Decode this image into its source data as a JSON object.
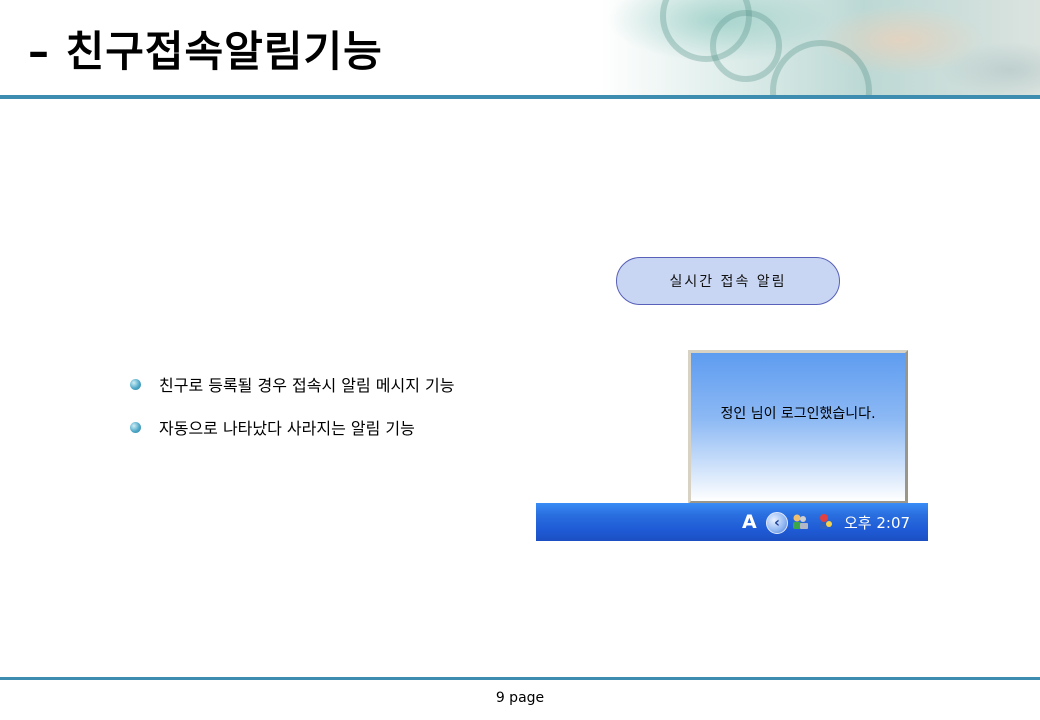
{
  "header": {
    "title": "– 친구접속알림기능"
  },
  "bullets": [
    {
      "text": "친구로 등록될 경우 접속시 알림 메시지 기능"
    },
    {
      "text": "자동으로 나타났다 사라지는 알림 기능"
    }
  ],
  "callout": {
    "label": "실시간 접속 알림"
  },
  "notification": {
    "message": "정인 님이 로그인했습니다."
  },
  "taskbar": {
    "ime_label": "A",
    "clock": "오후 2:07",
    "icons": [
      "show-hidden-icons-chevron-icon",
      "network-users-icon",
      "messenger-icon"
    ]
  },
  "footer": {
    "page_label": "9 page"
  },
  "colors": {
    "rule": "#3d8db0",
    "callout_fill": "#c9d6f3",
    "callout_border": "#5860b8",
    "taskbar_blue": "#2a6fe0"
  }
}
